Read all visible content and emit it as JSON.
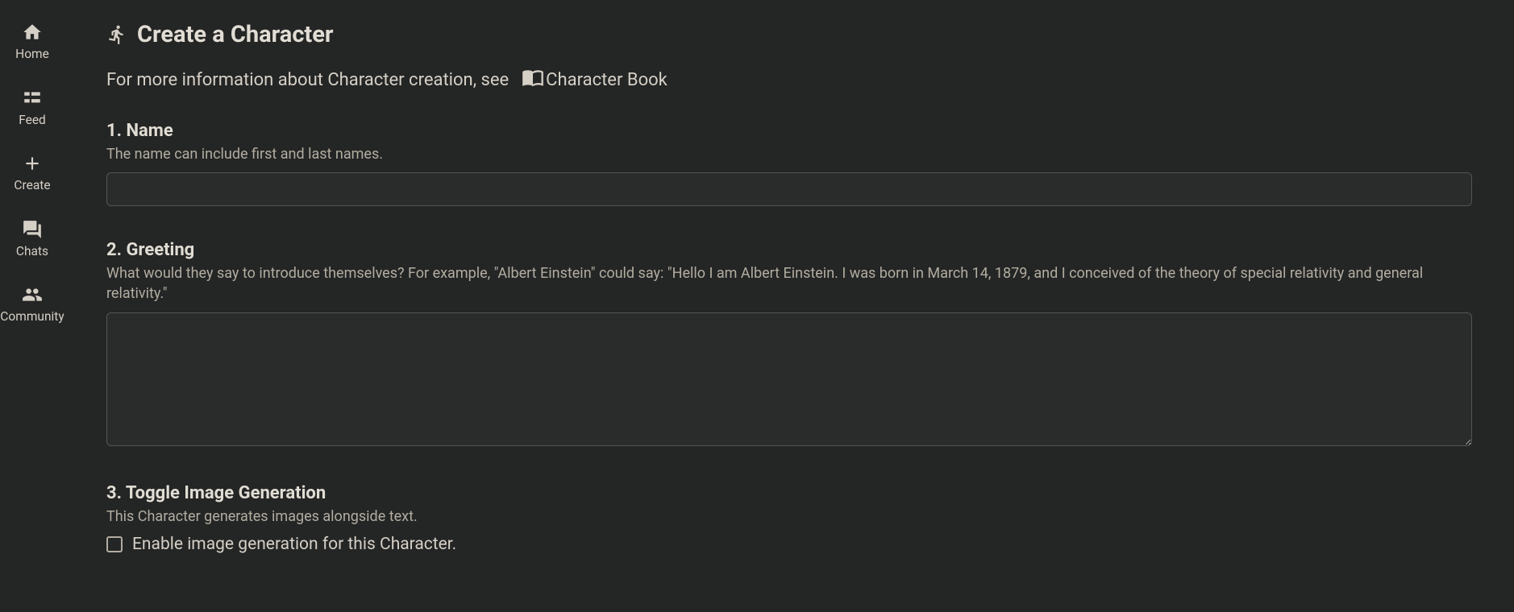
{
  "sidebar": {
    "items": [
      {
        "label": "Home",
        "icon": "home-icon"
      },
      {
        "label": "Feed",
        "icon": "feed-icon"
      },
      {
        "label": "Create",
        "icon": "plus-icon"
      },
      {
        "label": "Chats",
        "icon": "chats-icon"
      },
      {
        "label": "Community",
        "icon": "community-icon"
      }
    ]
  },
  "header": {
    "title": "Create a Character"
  },
  "info": {
    "text": "For more information about Character creation, see",
    "link_label": "Character Book"
  },
  "sections": {
    "name": {
      "heading": "1. Name",
      "help": "The name can include first and last names.",
      "value": ""
    },
    "greeting": {
      "heading": "2. Greeting",
      "help": "What would they say to introduce themselves? For example, \"Albert Einstein\" could say: \"Hello I am Albert Einstein. I was born in March 14, 1879, and I conceived of the theory of special relativity and general relativity.\"",
      "value": ""
    },
    "image_gen": {
      "heading": "3. Toggle Image Generation",
      "help": "This Character generates images alongside text.",
      "checkbox_label": "Enable image generation for this Character.",
      "checked": false
    }
  }
}
